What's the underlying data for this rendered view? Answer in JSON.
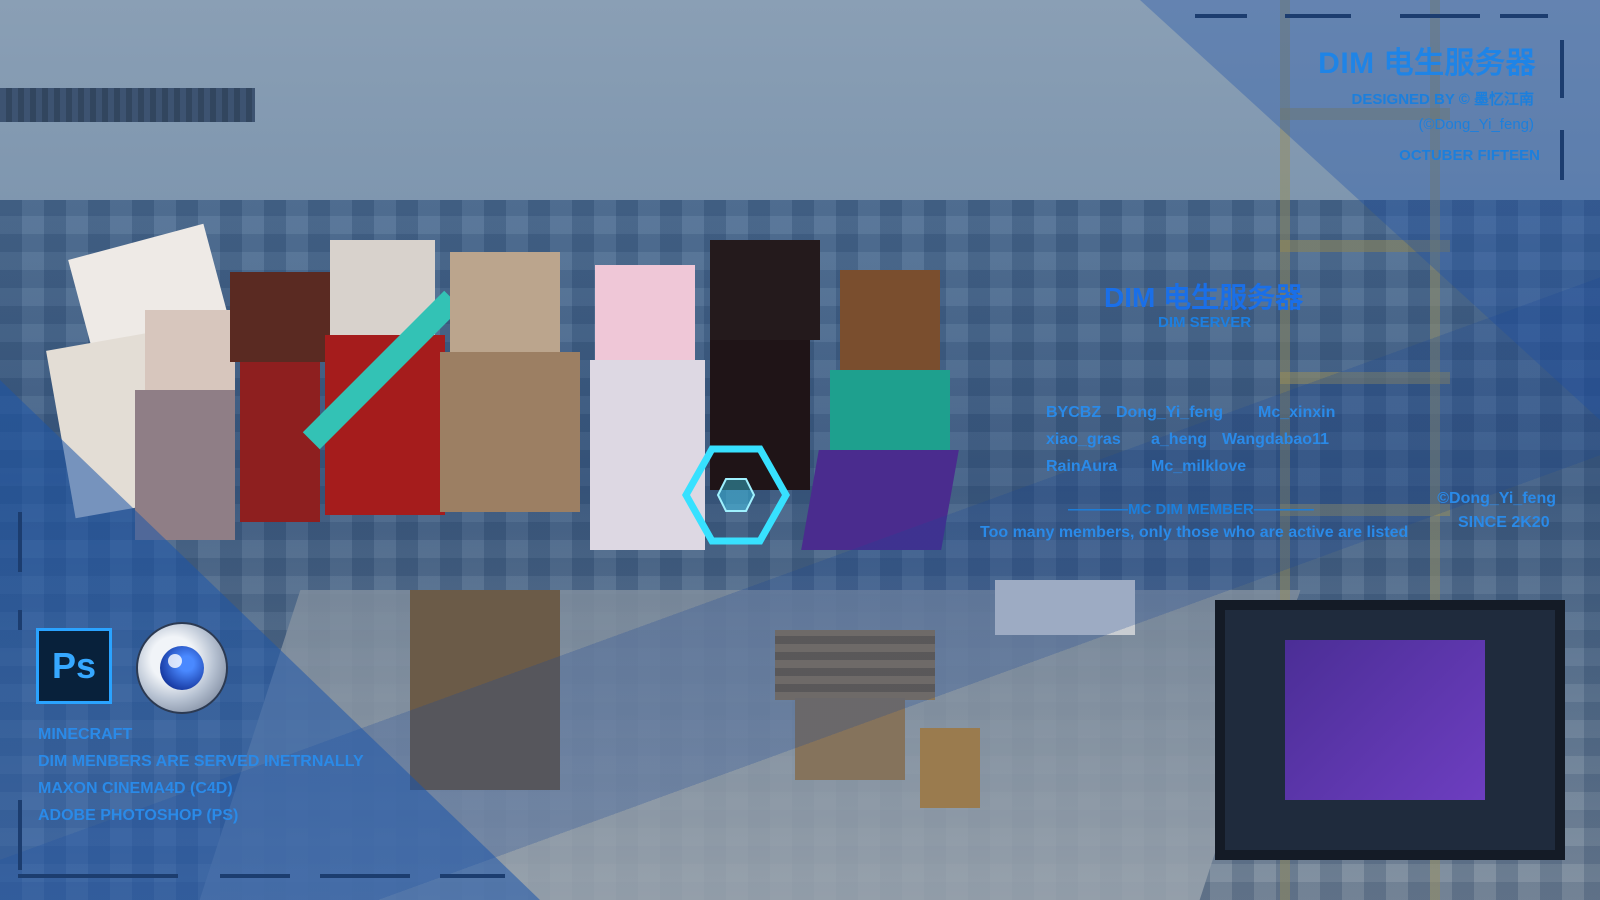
{
  "header": {
    "title": "DIM 电生服务器",
    "designed_by": "DESIGNED BY © 墨忆江南",
    "copyright": "(©Dong_Yi_feng)",
    "date": "OCTUBER FIFTEEN"
  },
  "center": {
    "title": "DIM 电生服务器",
    "subtitle": "DIM SERVER"
  },
  "members": {
    "rows": [
      [
        "BYCBZ",
        "Dong_Yi_feng",
        "Mc_xinxin"
      ],
      [
        "xiao_gras",
        "a_heng",
        "Wangdabao11"
      ],
      [
        "RainAura",
        "Mc_milklove"
      ]
    ],
    "heading": "————MC DIM MEMBER————",
    "note": "Too many members, only those who are active are listed"
  },
  "signature": {
    "author": "©Dong_Yi_feng",
    "since": "SINCE 2K20"
  },
  "tools": {
    "ps_label": "Ps",
    "lines": [
      "MINECRAFT",
      "DIM MENBERS ARE SERVED INETRNALLY",
      "MAXON CINEMA4D (C4D)",
      "ADOBE PHOTOSHOP (PS)"
    ]
  },
  "colors": {
    "accent": "#1f7fe0",
    "overlay_blue": "#1e55aa",
    "portal": "#6d3ec0"
  }
}
